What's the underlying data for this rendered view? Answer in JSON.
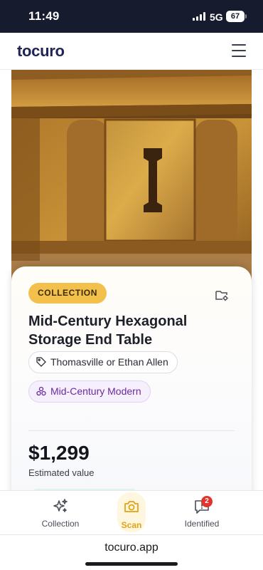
{
  "status_bar": {
    "time": "11:49",
    "network": "5G",
    "battery": "67"
  },
  "header": {
    "logo": "tocuro"
  },
  "item": {
    "badge": "COLLECTION",
    "title": "Mid-Century Hexagonal Storage End Table",
    "brand": "Thomasville or Ethan Allen",
    "style": "Mid-Century Modern",
    "price": "$1,299",
    "price_label": "Estimated value"
  },
  "nav": [
    {
      "label": "Collection",
      "icon": "sparkles-icon"
    },
    {
      "label": "Scan",
      "icon": "camera-icon"
    },
    {
      "label": "Identified",
      "icon": "message-alert-icon",
      "badge": "2"
    }
  ],
  "browser": {
    "url": "tocuro.app"
  },
  "colors": {
    "accent": "#f3c14b",
    "brand": "#1f2456",
    "style_chip": "#6b2a9f",
    "alert": "#e0352e"
  }
}
